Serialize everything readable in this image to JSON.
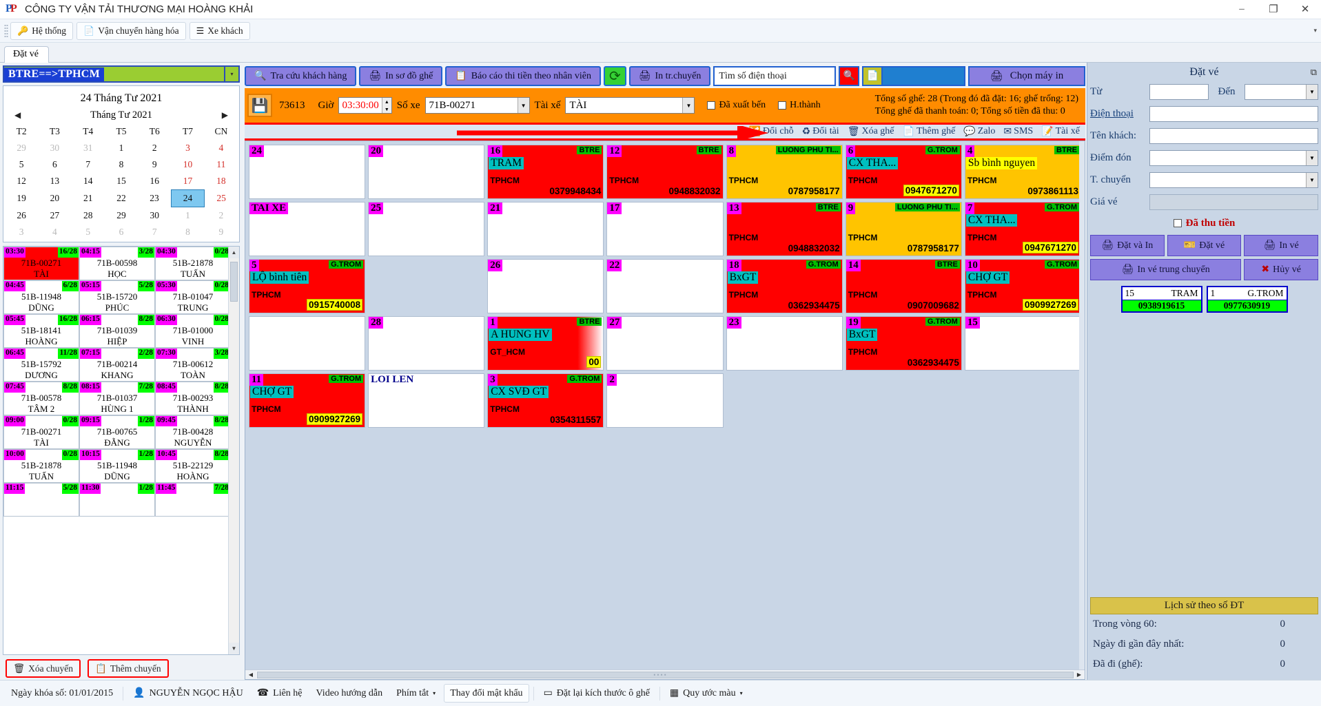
{
  "window": {
    "title": "CÔNG TY VẬN TẢI THƯƠNG MẠI HOÀNG KHẢI",
    "minimize": "–",
    "maximize": "❐",
    "close": "✕"
  },
  "menu": {
    "items": [
      {
        "label": "Hệ thống",
        "icon": "keys-icon"
      },
      {
        "label": "Vận chuyển hàng hóa",
        "icon": "document-add-icon"
      },
      {
        "label": "Xe khách",
        "icon": "list-icon"
      }
    ],
    "overflow": "▾"
  },
  "tabs": [
    {
      "label": "Đặt vé"
    }
  ],
  "route": {
    "value": "BTRE==>TPHCM",
    "dropdown": "▾"
  },
  "calendar": {
    "selected_date_label": "24 Tháng Tư 2021",
    "month_label": "Tháng Tư 2021",
    "prev": "◀",
    "next": "▶",
    "weekdays": [
      "T2",
      "T3",
      "T4",
      "T5",
      "T6",
      "T7",
      "CN"
    ],
    "weeks": [
      [
        {
          "d": "29",
          "t": "mut"
        },
        {
          "d": "30",
          "t": "mut"
        },
        {
          "d": "31",
          "t": "mut"
        },
        {
          "d": "1",
          "t": ""
        },
        {
          "d": "2",
          "t": ""
        },
        {
          "d": "3",
          "t": "sat"
        },
        {
          "d": "4",
          "t": "sun"
        }
      ],
      [
        {
          "d": "5",
          "t": ""
        },
        {
          "d": "6",
          "t": ""
        },
        {
          "d": "7",
          "t": ""
        },
        {
          "d": "8",
          "t": ""
        },
        {
          "d": "9",
          "t": ""
        },
        {
          "d": "10",
          "t": "sat"
        },
        {
          "d": "11",
          "t": "sun"
        }
      ],
      [
        {
          "d": "12",
          "t": ""
        },
        {
          "d": "13",
          "t": ""
        },
        {
          "d": "14",
          "t": ""
        },
        {
          "d": "15",
          "t": ""
        },
        {
          "d": "16",
          "t": ""
        },
        {
          "d": "17",
          "t": "sat"
        },
        {
          "d": "18",
          "t": "sun"
        }
      ],
      [
        {
          "d": "19",
          "t": ""
        },
        {
          "d": "20",
          "t": ""
        },
        {
          "d": "21",
          "t": ""
        },
        {
          "d": "22",
          "t": ""
        },
        {
          "d": "23",
          "t": ""
        },
        {
          "d": "24",
          "t": "sel"
        },
        {
          "d": "25",
          "t": "sun"
        }
      ],
      [
        {
          "d": "26",
          "t": ""
        },
        {
          "d": "27",
          "t": ""
        },
        {
          "d": "28",
          "t": ""
        },
        {
          "d": "29",
          "t": ""
        },
        {
          "d": "30",
          "t": ""
        },
        {
          "d": "1",
          "t": "mut"
        },
        {
          "d": "2",
          "t": "mut"
        }
      ],
      [
        {
          "d": "3",
          "t": "mut"
        },
        {
          "d": "4",
          "t": "mut"
        },
        {
          "d": "5",
          "t": "mut"
        },
        {
          "d": "6",
          "t": "mut"
        },
        {
          "d": "7",
          "t": "mut"
        },
        {
          "d": "8",
          "t": "mut"
        },
        {
          "d": "9",
          "t": "mut"
        }
      ]
    ]
  },
  "trips": [
    {
      "time": "03:30",
      "count": "16/28",
      "plate": "71B-00271",
      "driver": "TÀI",
      "hot": true
    },
    {
      "time": "04:15",
      "count": "3/28",
      "plate": "71B-00598",
      "driver": "HỌC",
      "hot": false
    },
    {
      "time": "04:30",
      "count": "0/28",
      "plate": "51B-21878",
      "driver": "TUẤN",
      "hot": false
    },
    {
      "time": "04:45",
      "count": "6/28",
      "plate": "51B-11948",
      "driver": "DŨNG",
      "hot": false
    },
    {
      "time": "05:15",
      "count": "5/28",
      "plate": "51B-15720",
      "driver": "PHÚC",
      "hot": false
    },
    {
      "time": "05:30",
      "count": "0/28",
      "plate": "71B-01047",
      "driver": "TRUNG",
      "hot": false
    },
    {
      "time": "05:45",
      "count": "16/28",
      "plate": "51B-18141",
      "driver": "HOÀNG",
      "hot": false
    },
    {
      "time": "06:15",
      "count": "8/28",
      "plate": "71B-01039",
      "driver": "HIỆP",
      "hot": false
    },
    {
      "time": "06:30",
      "count": "0/28",
      "plate": "71B-01000",
      "driver": "VINH",
      "hot": false
    },
    {
      "time": "06:45",
      "count": "11/28",
      "plate": "51B-15792",
      "driver": "DƯƠNG",
      "hot": false
    },
    {
      "time": "07:15",
      "count": "2/28",
      "plate": "71B-00214",
      "driver": "KHANG",
      "hot": false
    },
    {
      "time": "07:30",
      "count": "3/28",
      "plate": "71B-00612",
      "driver": "TOÀN",
      "hot": false
    },
    {
      "time": "07:45",
      "count": "8/28",
      "plate": "71B-00578",
      "driver": "TÂM 2",
      "hot": false
    },
    {
      "time": "08:15",
      "count": "7/28",
      "plate": "71B-01037",
      "driver": "HÙNG 1",
      "hot": false
    },
    {
      "time": "08:45",
      "count": "8/28",
      "plate": "71B-00293",
      "driver": "THÀNH",
      "hot": false
    },
    {
      "time": "09:00",
      "count": "0/28",
      "plate": "71B-00271",
      "driver": "TÀI",
      "hot": false
    },
    {
      "time": "09:15",
      "count": "1/28",
      "plate": "71B-00765",
      "driver": "ĐẰNG",
      "hot": false
    },
    {
      "time": "09:45",
      "count": "8/28",
      "plate": "71B-00428",
      "driver": "NGUYỄN",
      "hot": false
    },
    {
      "time": "10:00",
      "count": "0/28",
      "plate": "51B-21878",
      "driver": "TUẤN",
      "hot": false
    },
    {
      "time": "10:15",
      "count": "1/28",
      "plate": "51B-11948",
      "driver": "DŨNG",
      "hot": false
    },
    {
      "time": "10:45",
      "count": "8/28",
      "plate": "51B-22129",
      "driver": "HOÀNG",
      "hot": false
    },
    {
      "time": "11:15",
      "count": "5/28",
      "plate": "",
      "driver": "",
      "hot": false
    },
    {
      "time": "11:30",
      "count": "1/28",
      "plate": "",
      "driver": "",
      "hot": false
    },
    {
      "time": "11:45",
      "count": "7/28",
      "plate": "",
      "driver": "",
      "hot": false
    }
  ],
  "left_footer": {
    "delete_trip": "Xóa chuyến",
    "add_trip": "Thêm chuyến"
  },
  "center_toolbar": {
    "lookup_customer": "Tra cứu khách hàng",
    "print_seatmap": "In sơ đồ ghế",
    "report_staff": "Báo cáo thi tiền theo nhân viên",
    "refresh": "⟳",
    "print_trip": "In tr.chuyến",
    "phone_search_value": "Tìm số điện thoại",
    "search_icon": "magnifier-icon",
    "list_icon": "report-icon",
    "choose_printer": "Chọn máy in"
  },
  "trip_bar": {
    "save_icon": "save-icon",
    "trip_id": "73613",
    "time_label": "Giờ",
    "time_value": "03:30:00",
    "vehicle_label": "Số xe",
    "vehicle_value": "71B-00271",
    "driver_label": "Tài xế",
    "driver_value": "TÀI",
    "departed_label": "Đã xuất bến",
    "completed_label": "H.thành",
    "totals_line1": "Tổng số ghế: 28 (Trong  đó đã đặt: 16; ghế trống: 12)",
    "totals_line2": "Tổng ghế đã thanh toán: 0; Tổng số tiền đã thu: 0"
  },
  "action_bar": {
    "swap_seat": "Đổi chỗ",
    "swap_vehicle": "Đổi tài",
    "delete_seat": "Xóa ghế",
    "add_seat": "Thêm ghế",
    "zalo": "Zalo",
    "sms": "SMS",
    "driver": "Tài xế"
  },
  "seats": [
    {
      "no": "24",
      "state": "empty"
    },
    {
      "no": "20",
      "state": "empty"
    },
    {
      "no": "16",
      "state": "red",
      "dest": "BTRE",
      "cust": "TRAM",
      "city": "TPHCM",
      "phone": "0379948434",
      "hl": false
    },
    {
      "no": "12",
      "state": "red",
      "dest": "BTRE",
      "cust": "",
      "city": "TPHCM",
      "phone": "0948832032",
      "hl": false
    },
    {
      "no": "8",
      "state": "amber",
      "dest": "LUONG PHU TI...",
      "cust": "",
      "city": "TPHCM",
      "phone": "0787958177",
      "hl": false
    },
    {
      "no": "6",
      "state": "red",
      "dest": "G.TROM",
      "cust": "CX THA...",
      "city": "TPHCM",
      "phone": "0947671270",
      "hl": true
    },
    {
      "no": "4",
      "state": "amber",
      "dest": "BTRE",
      "cust": "Sb bình nguyen",
      "city": "TPHCM",
      "phone": "0973861113",
      "hl": false
    },
    {
      "no": "TAI XE",
      "state": "driver"
    },
    {
      "no": "25",
      "state": "empty"
    },
    {
      "no": "21",
      "state": "empty"
    },
    {
      "no": "17",
      "state": "empty"
    },
    {
      "no": "13",
      "state": "red",
      "dest": "BTRE",
      "cust": "",
      "city": "TPHCM",
      "phone": "0948832032",
      "hl": false
    },
    {
      "no": "9",
      "state": "amber",
      "dest": "LUONG PHU TI...",
      "cust": "",
      "city": "TPHCM",
      "phone": "0787958177",
      "hl": false
    },
    {
      "no": "7",
      "state": "red",
      "dest": "G.TROM",
      "cust": "CX THA...",
      "city": "TPHCM",
      "phone": "0947671270",
      "hl": true
    },
    {
      "no": "5",
      "state": "red",
      "dest": "G.TROM",
      "cust": "LỘ bình tiên",
      "city": "TPHCM",
      "phone": "0915740008",
      "hl": true
    },
    {
      "no": "",
      "state": "blank"
    },
    {
      "no": "26",
      "state": "empty"
    },
    {
      "no": "22",
      "state": "empty"
    },
    {
      "no": "18",
      "state": "red",
      "dest": "G.TROM",
      "cust": "BxGT",
      "city": "TPHCM",
      "phone": "0362934475",
      "hl": false
    },
    {
      "no": "14",
      "state": "red",
      "dest": "BTRE",
      "cust": "",
      "city": "TPHCM",
      "phone": "0907009682",
      "hl": false
    },
    {
      "no": "10",
      "state": "red",
      "dest": "G.TROM",
      "cust": "CHỢ GT",
      "city": "TPHCM",
      "phone": "0909927269",
      "hl": true
    },
    {
      "no": "",
      "state": "empty-nonum"
    },
    {
      "no": "28",
      "state": "empty"
    },
    {
      "no": "1",
      "state": "fade",
      "dest": "BTRE",
      "cust": "A HUNG HV",
      "city": "GT_HCM",
      "phone": "00",
      "hl": true
    },
    {
      "no": "27",
      "state": "empty"
    },
    {
      "no": "23",
      "state": "empty"
    },
    {
      "no": "19",
      "state": "red",
      "dest": "G.TROM",
      "cust": "BxGT",
      "city": "TPHCM",
      "phone": "0362934475",
      "hl": false
    },
    {
      "no": "15",
      "state": "empty"
    },
    {
      "no": "11",
      "state": "red",
      "dest": "G.TROM",
      "cust": "CHỢ GT",
      "city": "TPHCM",
      "phone": "0909927269",
      "hl": true
    },
    {
      "no": "LOI LEN",
      "state": "label"
    },
    {
      "no": "3",
      "state": "red",
      "dest": "G.TROM",
      "cust": "CX SVĐ GT",
      "city": "TPHCM",
      "phone": "0354311557",
      "hl": false
    },
    {
      "no": "2",
      "state": "empty"
    }
  ],
  "booking": {
    "title": "Đặt vé",
    "from_label": "Từ",
    "from_value": "",
    "to_label": "Đến",
    "to_value": "",
    "phone_label": "Điện thoại",
    "phone_value": "",
    "name_label": "Tên khách:",
    "name_value": "",
    "pickup_label": "Điểm đón",
    "pickup_value": "",
    "transfer_label": "T. chuyển",
    "transfer_value": "",
    "price_label": "Giá vé",
    "price_value": "",
    "paid_label": "Đã thu tiền",
    "buttons": {
      "book_and_print": "Đặt và In",
      "book": "Đặt vé",
      "print": "In vé",
      "print_transfer": "In vé  trung chuyển",
      "cancel": "Hủy vé"
    },
    "tickets": [
      {
        "no": "15",
        "dest": "TRAM",
        "phone": "0938919615"
      },
      {
        "no": "1",
        "dest": "G.TROM",
        "phone": "0977630919"
      }
    ]
  },
  "history": {
    "title": "Lịch sử theo số ĐT",
    "rows": [
      {
        "label": "Trong vòng 60:",
        "value": "0"
      },
      {
        "label": "Ngày đi gần đây nhất:",
        "value": "0"
      },
      {
        "label": "Đã đi (ghế):",
        "value": "0"
      }
    ]
  },
  "statusbar": {
    "lock_date": "Ngày khóa số: 01/01/2015",
    "user": "NGUYỄN NGỌC HẬU",
    "contact": "Liên hệ",
    "video": "Video hướng dẫn",
    "shortcuts": "Phím tắt",
    "change_password": "Thay đổi mật khẩu",
    "reset_size": "Đặt lại kích thước ô ghế",
    "color_legend": "Quy ước màu"
  }
}
